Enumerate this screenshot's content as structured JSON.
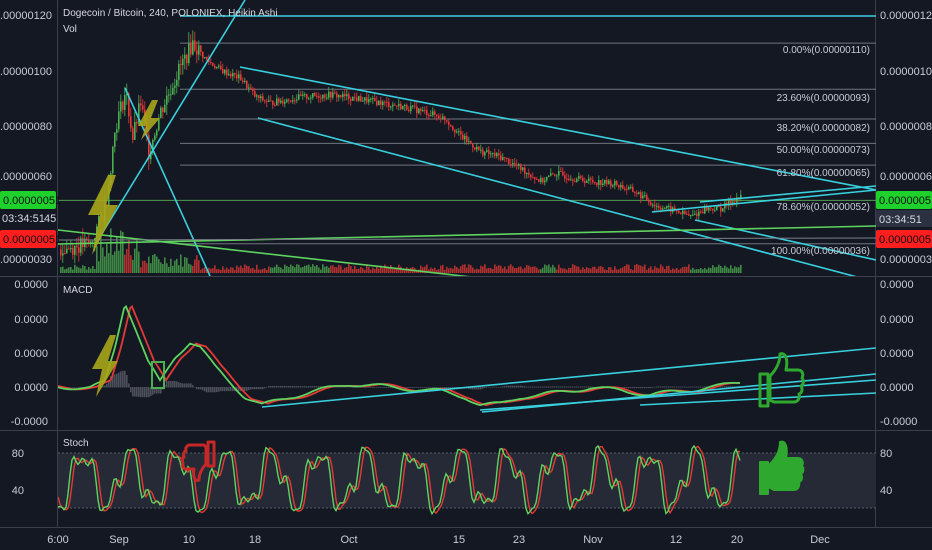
{
  "chart_title": "Dogecoin / Bitcoin, 240, POLONIEX, Heikin Ashi",
  "volume_label": "Vol",
  "macd_label": "MACD",
  "stoch_label": "Stoch",
  "price_axis_ticks": [
    "0.00000120",
    "0.00000100",
    "0.00000080",
    "0.00000060",
    "0.00000030"
  ],
  "price_axis_ticks_right": [
    "0.00000120",
    "0.00000100",
    "0.00000080",
    "0.00000060",
    "0.00000030"
  ],
  "macd_axis_ticks": [
    "0.0000",
    "0.0000",
    "0.0000",
    "0.0000",
    "-0.0000"
  ],
  "macd_axis_ticks_right": [
    "0.0000",
    "0.0000",
    "0.0000",
    "0.0000",
    "-0.0000"
  ],
  "stoch_axis_ticks": [
    "80",
    "40"
  ],
  "stoch_axis_ticks_right": [
    "80",
    "40"
  ],
  "time_axis": [
    "6:00",
    "Sep",
    "10",
    "18",
    "Oct",
    "15",
    "23",
    "Nov",
    "12",
    "20",
    "Dec"
  ],
  "price_badges": {
    "left_price": "0.00000051",
    "left_timer": "03:34:51",
    "left_timer_suffix": "45",
    "left_sell": "0.00000051",
    "right_price": "0.00000051",
    "right_timer": "03:34:51",
    "right_sell": "0.00000051"
  },
  "fib_levels": [
    {
      "label": "0.00%(0.00000110)"
    },
    {
      "label": "23.60%(0.00000093)"
    },
    {
      "label": "38.20%(0.00000082)"
    },
    {
      "label": "50.00%(0.00000073)"
    },
    {
      "label": "61.80%(0.00000065)"
    },
    {
      "label": "78.60%(0.00000052)"
    },
    {
      "label": "100.00%(0.00000036)"
    }
  ],
  "colors": {
    "background": "#141823",
    "up": "#4caf50",
    "down": "#e53935",
    "trendline": "#39d0de",
    "support": "#5fd35f",
    "fib": "#7b7f8a",
    "badge_green": "#1fd12b",
    "badge_red": "#ff1e1e",
    "icon_yellow": "#a7a61a",
    "icon_green": "#2ea82e"
  },
  "chart_data": {
    "type": "candlestick",
    "title": "Dogecoin / Bitcoin, 240, POLONIEX, Heikin Ashi",
    "x_ticks": [
      "6:00",
      "Sep",
      "10",
      "18",
      "Oct",
      "15",
      "23",
      "Nov",
      "12",
      "20",
      "Dec"
    ],
    "y_range": [
      3e-07,
      1.2e-06
    ],
    "price_path": [
      {
        "t": "6:00",
        "v": 3.4e-07
      },
      {
        "t": "Sep",
        "v": 9e-07
      },
      {
        "t": "10",
        "v": 1.08e-06
      },
      {
        "t": "18",
        "v": 9e-07
      },
      {
        "t": "Oct",
        "v": 8.8e-07
      },
      {
        "t": "15",
        "v": 7e-07
      },
      {
        "t": "23",
        "v": 6e-07
      },
      {
        "t": "Nov",
        "v": 5.8e-07
      },
      {
        "t": "12",
        "v": 4.7e-07
      },
      {
        "t": "20",
        "v": 5.3e-07
      }
    ],
    "fibonacci_retracement": [
      {
        "pct": 0.0,
        "price": 1.1e-06
      },
      {
        "pct": 23.6,
        "price": 9.3e-07
      },
      {
        "pct": 38.2,
        "price": 8.2e-07
      },
      {
        "pct": 50.0,
        "price": 7.3e-07
      },
      {
        "pct": 61.8,
        "price": 6.5e-07
      },
      {
        "pct": 78.6,
        "price": 5.2e-07
      },
      {
        "pct": 100.0,
        "price": 3.6e-07
      }
    ],
    "indicators": [
      "Vol",
      "MACD",
      "Stoch"
    ],
    "stoch_levels": [
      80,
      40
    ]
  }
}
